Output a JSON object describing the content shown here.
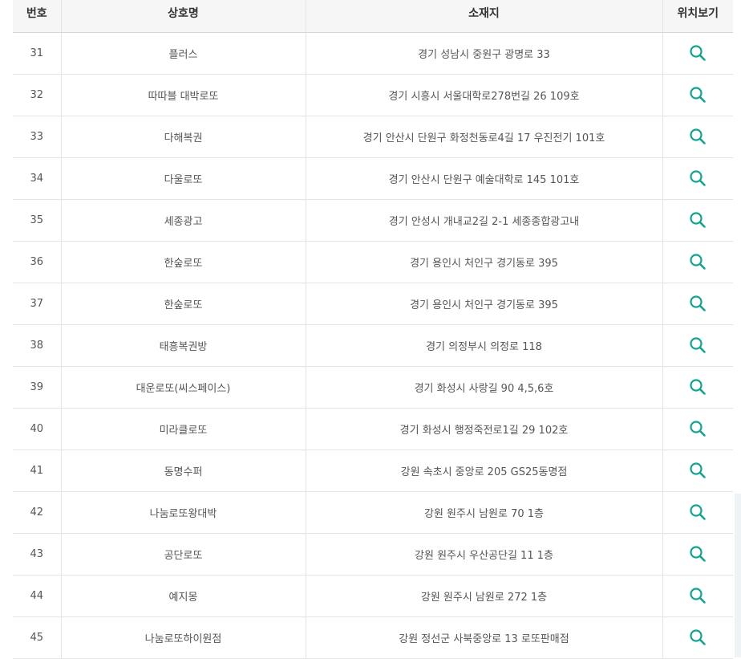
{
  "table": {
    "headers": [
      "번호",
      "상호명",
      "소재지",
      "위치보기"
    ],
    "rows": [
      {
        "num": "31",
        "name": "플러스",
        "address": "경기 성남시 중원구 광명로 33"
      },
      {
        "num": "32",
        "name": "따따블 대박로또",
        "address": "경기 시흥시 서울대학로278번길 26 109호"
      },
      {
        "num": "33",
        "name": "다해복권",
        "address": "경기 안산시 단원구 화정천동로4길 17 우진전기 101호"
      },
      {
        "num": "34",
        "name": "다울로또",
        "address": "경기 안산시 단원구 예술대학로 145 101호"
      },
      {
        "num": "35",
        "name": "세종광고",
        "address": "경기 안성시 개내교2길 2-1 세종종합광고내"
      },
      {
        "num": "36",
        "name": "한숲로또",
        "address": "경기 용인시 처인구 경기동로 395"
      },
      {
        "num": "37",
        "name": "한숲로또",
        "address": "경기 용인시 처인구 경기동로 395"
      },
      {
        "num": "38",
        "name": "태흥복권방",
        "address": "경기 의정부시 의정로 118"
      },
      {
        "num": "39",
        "name": "대운로또(씨스페이스)",
        "address": "경기 화성시 사랑길 90 4,5,6호"
      },
      {
        "num": "40",
        "name": "미라클로또",
        "address": "경기 화성시 행정죽전로1길 29 102호"
      },
      {
        "num": "41",
        "name": "동명수퍼",
        "address": "강원 속초시 중앙로 205 GS25동명점"
      },
      {
        "num": "42",
        "name": "나눔로또왕대박",
        "address": "강원 원주시 남원로 70 1층"
      },
      {
        "num": "43",
        "name": "공단로또",
        "address": "강원 원주시 우산공단길 11 1층"
      },
      {
        "num": "44",
        "name": "예지몽",
        "address": "강원 원주시 남원로 272 1층"
      },
      {
        "num": "45",
        "name": "나눔로또하이원점",
        "address": "강원 정선군 사북중앙로 13 로또판매점"
      }
    ]
  },
  "icons": {
    "location_view": "search-icon"
  },
  "colors": {
    "accent": "#12a48e",
    "header_bg": "#f6f6f6",
    "border": "#e4e4e4"
  }
}
